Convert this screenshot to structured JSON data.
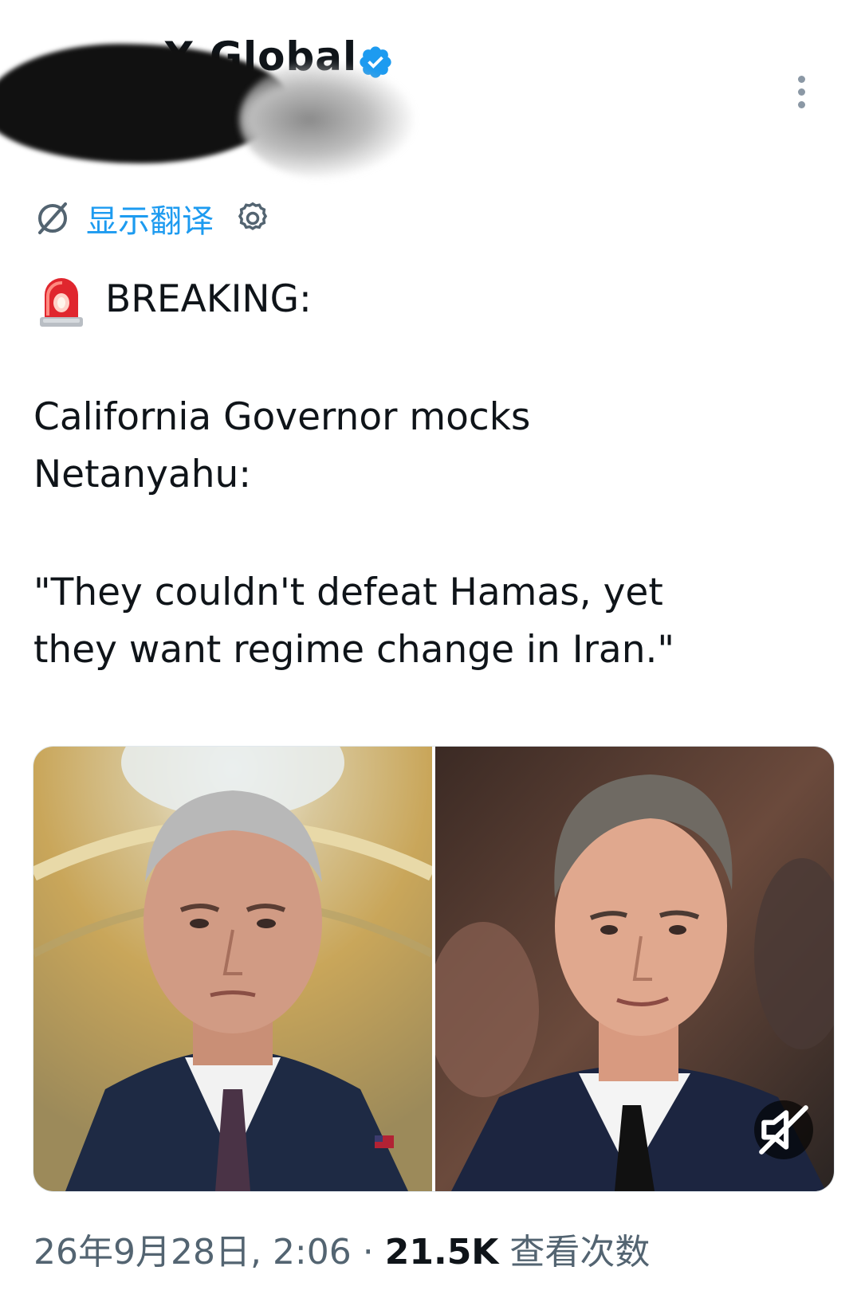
{
  "header": {
    "author_name": "X Global",
    "verified_icon": "verified-badge-icon",
    "more_icon": "more-vertical-icon"
  },
  "translate": {
    "icon": "translate-globe-icon",
    "label": "显示翻译",
    "settings_icon": "gear-icon"
  },
  "tweet": {
    "emoji_icon": "police-light-icon",
    "breaking": "BREAKING:",
    "headline": "California Governor mocks\nNetanyahu:",
    "quote": "\"They couldn't defeat Hamas, yet\nthey want regime change in Iran.\""
  },
  "media": {
    "count": 2,
    "mute_icon": "muted-speaker-icon"
  },
  "footer": {
    "timestamp": "26年9月28日, 2:06",
    "separator": "·",
    "views_count": "21.5K",
    "views_label": "查看次数"
  },
  "colors": {
    "link": "#1d9bf0",
    "verified": "#1d9bf0",
    "text": "#0f1419",
    "secondary": "#536471"
  }
}
